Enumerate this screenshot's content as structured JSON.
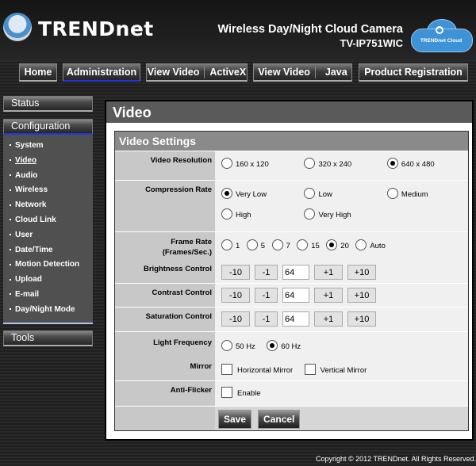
{
  "header": {
    "brand": "TRENDnet",
    "product_title": "Wireless Day/Night Cloud Camera",
    "product_model": "TV-IP751WIC",
    "cloud_badge": "TRENDnet Cloud"
  },
  "topnav": {
    "items": [
      {
        "label": "Home"
      },
      {
        "label": "Administration",
        "active": true
      },
      {
        "label": "View Video",
        "sub": "ActiveX"
      },
      {
        "label": "View Video",
        "sub": "Java"
      },
      {
        "label": "Product Registration"
      }
    ]
  },
  "sidebar": {
    "status": "Status",
    "configuration": "Configuration",
    "tools": "Tools",
    "items": [
      {
        "label": "System"
      },
      {
        "label": "Video",
        "current": true
      },
      {
        "label": "Audio"
      },
      {
        "label": "Wireless"
      },
      {
        "label": "Network"
      },
      {
        "label": "Cloud Link"
      },
      {
        "label": "User"
      },
      {
        "label": "Date/Time"
      },
      {
        "label": "Motion Detection"
      },
      {
        "label": "Upload"
      },
      {
        "label": "E-mail"
      },
      {
        "label": "Day/Night Mode"
      }
    ]
  },
  "main": {
    "page_title": "Video",
    "section_title": "Video Settings",
    "video_resolution": {
      "label": "Video Resolution",
      "options": [
        "160 x 120",
        "320 x 240",
        "640 x 480"
      ],
      "selected": "640 x 480"
    },
    "compression_rate": {
      "label": "Compression Rate",
      "options": [
        "Very Low",
        "Low",
        "Medium",
        "High",
        "Very High"
      ],
      "selected": "Very Low"
    },
    "frame_rate": {
      "label": "Frame Rate",
      "label2": "(Frames/Sec.)",
      "options": [
        "1",
        "5",
        "7",
        "15",
        "20",
        "Auto"
      ],
      "selected": "20"
    },
    "brightness": {
      "label": "Brightness Control",
      "value": "64"
    },
    "contrast": {
      "label": "Contrast Control",
      "value": "64"
    },
    "saturation": {
      "label": "Saturation Control",
      "value": "64"
    },
    "step_buttons": [
      "-10",
      "-1",
      "+1",
      "+10"
    ],
    "light_frequency": {
      "label": "Light Frequency",
      "options": [
        "50 Hz",
        "60 Hz"
      ],
      "selected": "60 Hz"
    },
    "mirror": {
      "label": "Mirror",
      "horizontal": "Horizontal Mirror",
      "vertical": "Vertical Mirror",
      "horizontal_checked": false,
      "vertical_checked": false
    },
    "anti_flicker": {
      "label": "Anti-Flicker",
      "option": "Enable",
      "checked": false
    },
    "save": "Save",
    "cancel": "Cancel"
  },
  "footer": {
    "copyright": "Copyright © 2012 TRENDnet.  All Rights Reserved."
  }
}
